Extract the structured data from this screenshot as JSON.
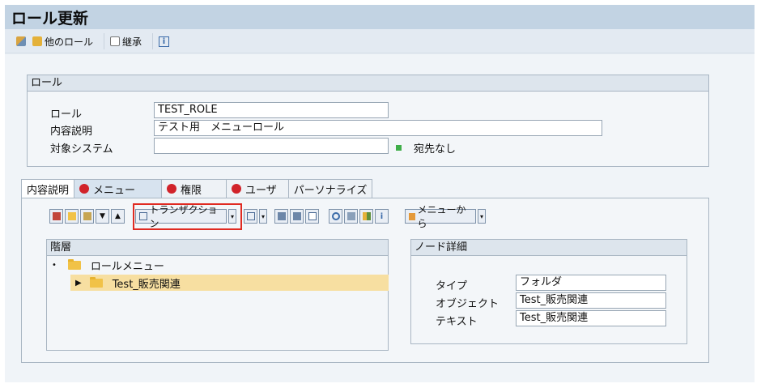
{
  "window": {
    "title": "ロール更新"
  },
  "appbar": {
    "other_roles": "他のロール",
    "inherit": "継承",
    "info_glyph": "i"
  },
  "role_group": {
    "header": "ロール",
    "role_label": "ロール",
    "role_value": "TEST_ROLE",
    "desc_label": "内容説明",
    "desc_value": "テスト用　メニューロール",
    "system_label": "対象システム",
    "system_value": "",
    "status_text": "宛先なし",
    "status_color": "#3fae49"
  },
  "tabs": [
    {
      "label": "内容説明",
      "status": "none"
    },
    {
      "label": "メニュー",
      "status": "red"
    },
    {
      "label": "権限",
      "status": "red"
    },
    {
      "label": "ユーザ",
      "status": "red"
    },
    {
      "label": "パーソナライズ",
      "status": "none"
    }
  ],
  "menu_toolbar": {
    "transaction_button": "トランザクション",
    "from_menu_button": "メニューから",
    "info_glyph": "i"
  },
  "hierarchy": {
    "header": "階層",
    "items": [
      {
        "label": "ロールメニュー",
        "marker": "•"
      },
      {
        "label": "Test_販売関連",
        "marker": "▶"
      }
    ]
  },
  "node_detail": {
    "header": "ノード詳細",
    "type_label": "タイプ",
    "type_value": "フォルダ",
    "object_label": "オブジェクト",
    "object_value": "Test_販売関連",
    "text_label": "テキスト",
    "text_value": "Test_販売関連"
  },
  "colors": {
    "title_bar": "#c2d3e3",
    "highlight": "#e02a21",
    "selected_row": "#f7dfa1",
    "tab_error": "#d1232a"
  }
}
